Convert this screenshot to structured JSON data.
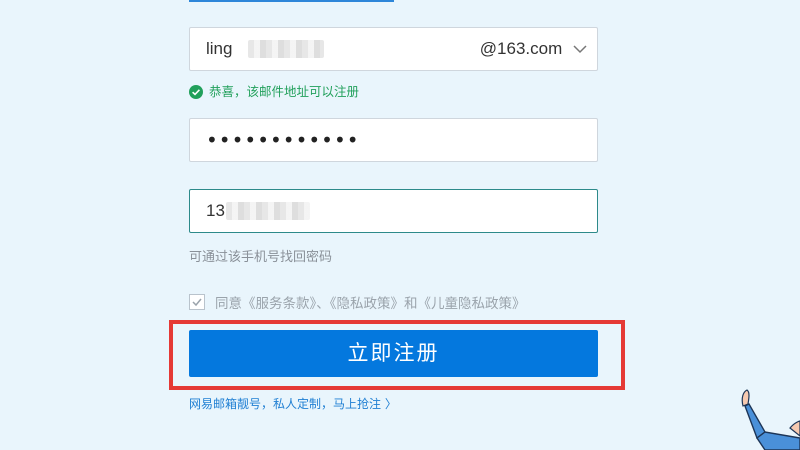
{
  "form": {
    "email": {
      "value": "ling",
      "domain": "@163.com"
    },
    "email_status": "恭喜，该邮件地址可以注册",
    "password": {
      "masked": "••••••••••••"
    },
    "phone": {
      "value": "13",
      "hint": "可通过该手机号找回密码"
    },
    "agreement": "同意《服务条款》、《隐私政策》和《儿童隐私政策》",
    "submit_label": "立即注册",
    "promo_link": "网易邮箱靓号，私人定制，马上抢注 〉"
  },
  "colors": {
    "background": "#e9f5fc",
    "button": "#0478de",
    "success": "#21a05b",
    "highlight_frame": "#e53935"
  },
  "icons": {
    "email_domain_dropdown": "chevron-down-icon",
    "email_status": "check-circle-icon",
    "agreement": "checkbox-checked-icon"
  }
}
